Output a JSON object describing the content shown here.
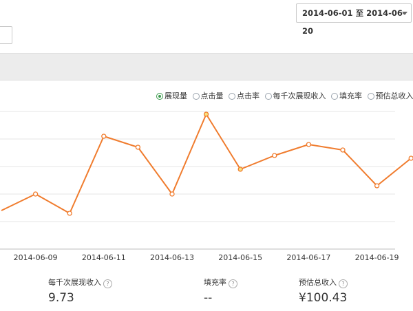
{
  "date_range": {
    "label": "2014-06-01 至 2014-06-20"
  },
  "metric_tabs": [
    {
      "label": "展现量",
      "active": true
    },
    {
      "label": "点击量",
      "active": false
    },
    {
      "label": "点击率",
      "active": false
    },
    {
      "label": "每千次展现收入",
      "active": false
    },
    {
      "label": "填充率",
      "active": false
    },
    {
      "label": "预估总收入",
      "active": false
    }
  ],
  "colors": {
    "line": "#f07c2e",
    "grid": "#e6e6e6",
    "active_radio": "#3c9b4e"
  },
  "chart_data": {
    "type": "line",
    "x": [
      "2014-06-08",
      "2014-06-09",
      "2014-06-10",
      "2014-06-11",
      "2014-06-12",
      "2014-06-13",
      "2014-06-14",
      "2014-06-15",
      "2014-06-16",
      "2014-06-17",
      "2014-06-18",
      "2014-06-19",
      "2014-06-20"
    ],
    "tick_labels": [
      "2014-06-09",
      "2014-06-11",
      "2014-06-13",
      "2014-06-15",
      "2014-06-17",
      "2014-06-19"
    ],
    "values": [
      1.4,
      2.0,
      1.3,
      4.1,
      3.7,
      2.0,
      4.9,
      2.9,
      3.4,
      3.8,
      3.6,
      2.3,
      3.3
    ],
    "highlighted_points": [
      "2014-06-14",
      "2014-06-15"
    ],
    "ylim": [
      0,
      5.0
    ],
    "grid": true
  },
  "stats": [
    {
      "label": "每千次展现收入",
      "value": "9.73"
    },
    {
      "label": "填充率",
      "value": "--"
    },
    {
      "label": "预估总收入",
      "value": "¥100.43"
    }
  ]
}
